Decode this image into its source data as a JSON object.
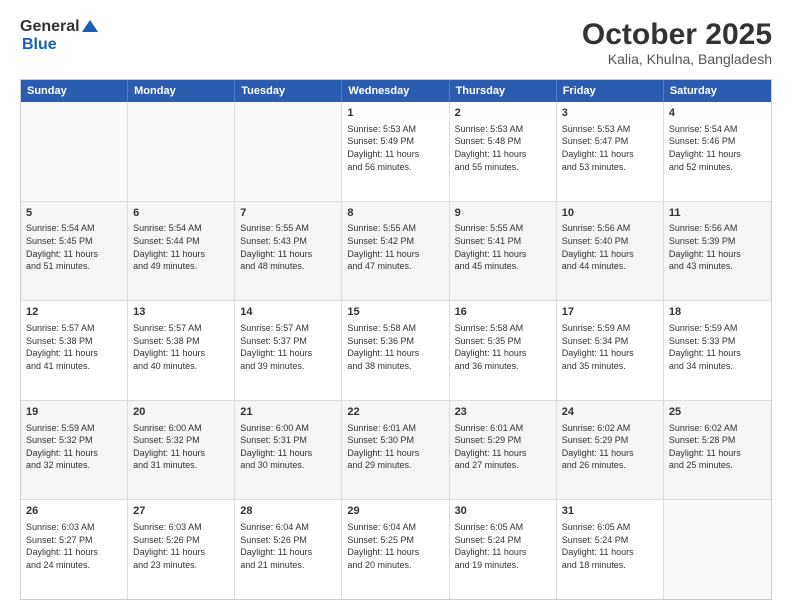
{
  "header": {
    "logo_general": "General",
    "logo_blue": "Blue",
    "title": "October 2025",
    "subtitle": "Kalia, Khulna, Bangladesh"
  },
  "calendar": {
    "days_of_week": [
      "Sunday",
      "Monday",
      "Tuesday",
      "Wednesday",
      "Thursday",
      "Friday",
      "Saturday"
    ],
    "weeks": [
      [
        {
          "day": "",
          "info": ""
        },
        {
          "day": "",
          "info": ""
        },
        {
          "day": "",
          "info": ""
        },
        {
          "day": "1",
          "info": "Sunrise: 5:53 AM\nSunset: 5:49 PM\nDaylight: 11 hours\nand 56 minutes."
        },
        {
          "day": "2",
          "info": "Sunrise: 5:53 AM\nSunset: 5:48 PM\nDaylight: 11 hours\nand 55 minutes."
        },
        {
          "day": "3",
          "info": "Sunrise: 5:53 AM\nSunset: 5:47 PM\nDaylight: 11 hours\nand 53 minutes."
        },
        {
          "day": "4",
          "info": "Sunrise: 5:54 AM\nSunset: 5:46 PM\nDaylight: 11 hours\nand 52 minutes."
        }
      ],
      [
        {
          "day": "5",
          "info": "Sunrise: 5:54 AM\nSunset: 5:45 PM\nDaylight: 11 hours\nand 51 minutes."
        },
        {
          "day": "6",
          "info": "Sunrise: 5:54 AM\nSunset: 5:44 PM\nDaylight: 11 hours\nand 49 minutes."
        },
        {
          "day": "7",
          "info": "Sunrise: 5:55 AM\nSunset: 5:43 PM\nDaylight: 11 hours\nand 48 minutes."
        },
        {
          "day": "8",
          "info": "Sunrise: 5:55 AM\nSunset: 5:42 PM\nDaylight: 11 hours\nand 47 minutes."
        },
        {
          "day": "9",
          "info": "Sunrise: 5:55 AM\nSunset: 5:41 PM\nDaylight: 11 hours\nand 45 minutes."
        },
        {
          "day": "10",
          "info": "Sunrise: 5:56 AM\nSunset: 5:40 PM\nDaylight: 11 hours\nand 44 minutes."
        },
        {
          "day": "11",
          "info": "Sunrise: 5:56 AM\nSunset: 5:39 PM\nDaylight: 11 hours\nand 43 minutes."
        }
      ],
      [
        {
          "day": "12",
          "info": "Sunrise: 5:57 AM\nSunset: 5:38 PM\nDaylight: 11 hours\nand 41 minutes."
        },
        {
          "day": "13",
          "info": "Sunrise: 5:57 AM\nSunset: 5:38 PM\nDaylight: 11 hours\nand 40 minutes."
        },
        {
          "day": "14",
          "info": "Sunrise: 5:57 AM\nSunset: 5:37 PM\nDaylight: 11 hours\nand 39 minutes."
        },
        {
          "day": "15",
          "info": "Sunrise: 5:58 AM\nSunset: 5:36 PM\nDaylight: 11 hours\nand 38 minutes."
        },
        {
          "day": "16",
          "info": "Sunrise: 5:58 AM\nSunset: 5:35 PM\nDaylight: 11 hours\nand 36 minutes."
        },
        {
          "day": "17",
          "info": "Sunrise: 5:59 AM\nSunset: 5:34 PM\nDaylight: 11 hours\nand 35 minutes."
        },
        {
          "day": "18",
          "info": "Sunrise: 5:59 AM\nSunset: 5:33 PM\nDaylight: 11 hours\nand 34 minutes."
        }
      ],
      [
        {
          "day": "19",
          "info": "Sunrise: 5:59 AM\nSunset: 5:32 PM\nDaylight: 11 hours\nand 32 minutes."
        },
        {
          "day": "20",
          "info": "Sunrise: 6:00 AM\nSunset: 5:32 PM\nDaylight: 11 hours\nand 31 minutes."
        },
        {
          "day": "21",
          "info": "Sunrise: 6:00 AM\nSunset: 5:31 PM\nDaylight: 11 hours\nand 30 minutes."
        },
        {
          "day": "22",
          "info": "Sunrise: 6:01 AM\nSunset: 5:30 PM\nDaylight: 11 hours\nand 29 minutes."
        },
        {
          "day": "23",
          "info": "Sunrise: 6:01 AM\nSunset: 5:29 PM\nDaylight: 11 hours\nand 27 minutes."
        },
        {
          "day": "24",
          "info": "Sunrise: 6:02 AM\nSunset: 5:29 PM\nDaylight: 11 hours\nand 26 minutes."
        },
        {
          "day": "25",
          "info": "Sunrise: 6:02 AM\nSunset: 5:28 PM\nDaylight: 11 hours\nand 25 minutes."
        }
      ],
      [
        {
          "day": "26",
          "info": "Sunrise: 6:03 AM\nSunset: 5:27 PM\nDaylight: 11 hours\nand 24 minutes."
        },
        {
          "day": "27",
          "info": "Sunrise: 6:03 AM\nSunset: 5:26 PM\nDaylight: 11 hours\nand 23 minutes."
        },
        {
          "day": "28",
          "info": "Sunrise: 6:04 AM\nSunset: 5:26 PM\nDaylight: 11 hours\nand 21 minutes."
        },
        {
          "day": "29",
          "info": "Sunrise: 6:04 AM\nSunset: 5:25 PM\nDaylight: 11 hours\nand 20 minutes."
        },
        {
          "day": "30",
          "info": "Sunrise: 6:05 AM\nSunset: 5:24 PM\nDaylight: 11 hours\nand 19 minutes."
        },
        {
          "day": "31",
          "info": "Sunrise: 6:05 AM\nSunset: 5:24 PM\nDaylight: 11 hours\nand 18 minutes."
        },
        {
          "day": "",
          "info": ""
        }
      ]
    ]
  }
}
